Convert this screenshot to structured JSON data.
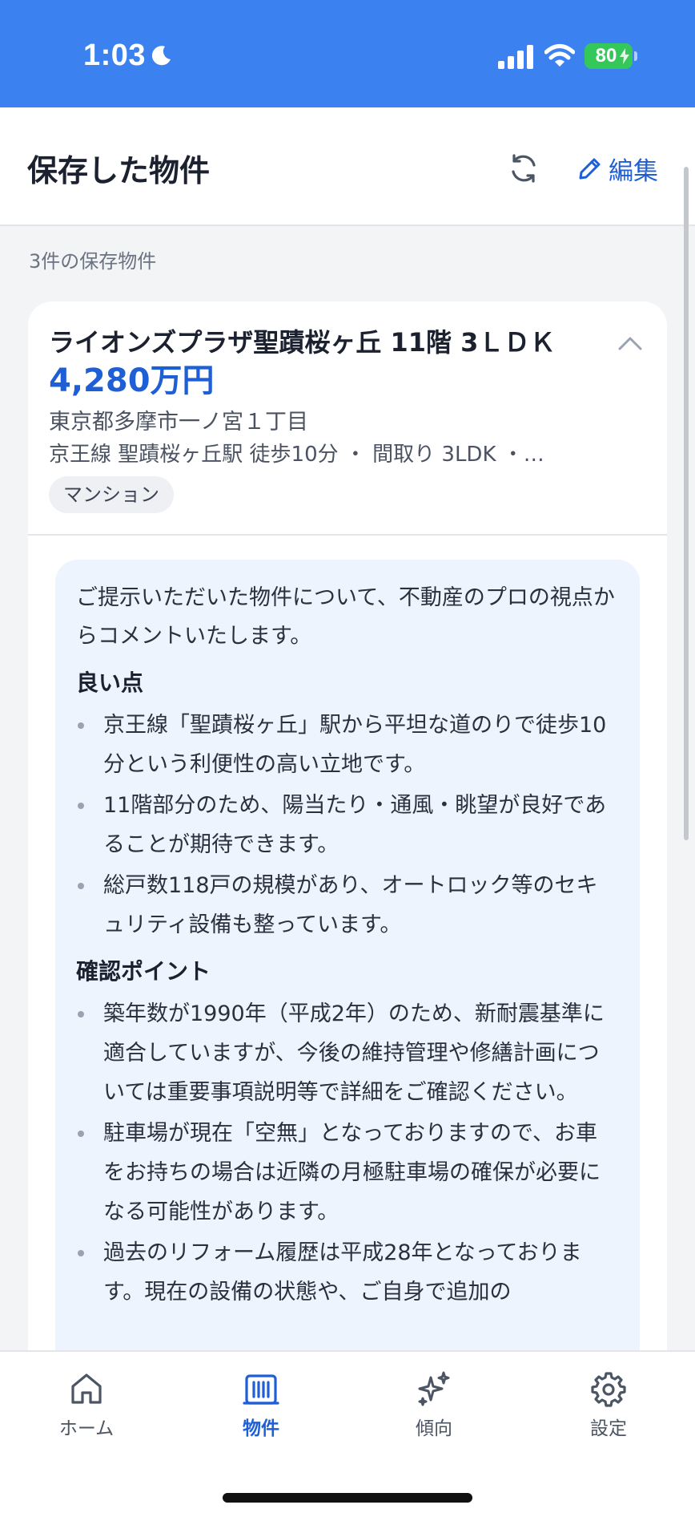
{
  "status_bar": {
    "time": "1:03",
    "battery": "80",
    "icons": [
      "moon-icon",
      "signal-icon",
      "wifi-icon",
      "battery-icon"
    ]
  },
  "header": {
    "title": "保存した物件",
    "edit_label": "編集",
    "icons": [
      "refresh-icon",
      "pencil-icon"
    ],
    "accent_color": "#1f5fd6"
  },
  "saved_count": "3件の保存物件",
  "property": {
    "name": "ライオンズプラザ聖蹟桜ヶ丘 11階 3ＬＤＫ",
    "price": "4,280万円",
    "address": "東京都多摩市一ノ宮１丁目",
    "meta": "京王線 聖蹟桜ヶ丘駅 徒歩10分 ・ 間取り 3LDK ・…",
    "tag": "マンション"
  },
  "comment": {
    "intro": "ご提示いただいた物件について、不動産のプロの視点からコメントいたします。",
    "sections": [
      {
        "heading": "良い点",
        "items": [
          "京王線「聖蹟桜ヶ丘」駅から平坦な道のりで徒歩10分という利便性の高い立地です。",
          "11階部分のため、陽当たり・通風・眺望が良好であることが期待できます。",
          "総戸数118戸の規模があり、オートロック等のセキュリティ設備も整っています。"
        ]
      },
      {
        "heading": "確認ポイント",
        "items": [
          "築年数が1990年（平成2年）のため、新耐震基準に適合していますが、今後の維持管理や修繕計画については重要事項説明等で詳細をご確認ください。",
          "駐車場が現在「空無」となっておりますので、お車をお持ちの場合は近隣の月極駐車場の確保が必要になる可能性があります。",
          "過去のリフォーム履歴は平成28年となっております。現在の設備の状態や、ご自身で追加の"
        ]
      }
    ]
  },
  "tabs": [
    {
      "label": "ホーム",
      "icon": "home-icon",
      "active": false
    },
    {
      "label": "物件",
      "icon": "building-icon",
      "active": true
    },
    {
      "label": "傾向",
      "icon": "sparkles-icon",
      "active": false
    },
    {
      "label": "設定",
      "icon": "gear-icon",
      "active": false
    }
  ]
}
